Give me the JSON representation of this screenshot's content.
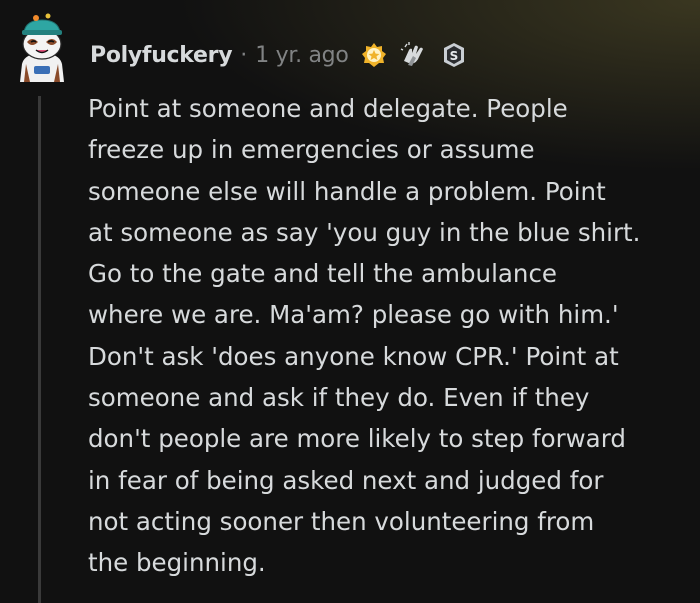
{
  "comment": {
    "username": "Polyfuckery",
    "separator": "·",
    "age": "1 yr. ago",
    "awards": [
      {
        "icon": "helpful-award-icon",
        "color": "#f0b32a"
      },
      {
        "icon": "high-five-award-icon",
        "color": "#d7dadc"
      },
      {
        "icon": "silver-award-icon",
        "color": "#c9ced3"
      }
    ],
    "body_lines": [
      "Point at someone and delegate. People",
      "freeze up in emergencies or assume",
      "someone else will handle a problem. Point",
      "at someone as say 'you guy in the blue shirt.",
      "Go to the gate and tell the ambulance",
      "where we are. Ma'am? please go with him.'",
      "Don't ask 'does anyone know CPR.' Point at",
      "someone and ask if they do. Even if they",
      "don't people are more likely to step forward",
      "in fear of being asked next and judged for",
      "not acting sooner then volunteering from",
      "the beginning."
    ]
  },
  "colors": {
    "background": "#111111",
    "text": "#d7dadc",
    "muted": "#818384",
    "thread_line": "#3a3a3a",
    "avatar_teal": "#2ea6a3"
  }
}
